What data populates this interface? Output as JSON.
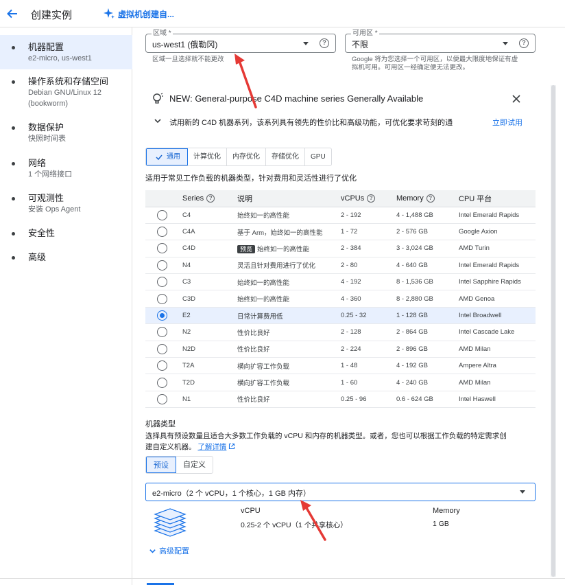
{
  "header": {
    "title": "创建实例",
    "vm_link": "虚拟机创建自..."
  },
  "sidebar": {
    "items": [
      {
        "title": "机器配置",
        "sub": "e2-micro, us-west1"
      },
      {
        "title": "操作系统和存储空间",
        "sub": "Debian GNU/Linux 12",
        "sub2": "(bookworm)"
      },
      {
        "title": "数据保护",
        "sub": "快照时间表"
      },
      {
        "title": "网络",
        "sub": "1 个网络接口"
      },
      {
        "title": "可观测性",
        "sub": "安装 Ops Agent"
      },
      {
        "title": "安全性",
        "sub": ""
      },
      {
        "title": "高级",
        "sub": ""
      }
    ]
  },
  "region": {
    "label": "区域 *",
    "value": "us-west1 (俄勒冈)",
    "helper": "区域一旦选择就不能更改"
  },
  "zone": {
    "label": "可用区 *",
    "value": "不限",
    "helper_line1": "Google 将为您选择一个可用区，以便最大限度地保证有虚",
    "helper_line2": "拟机可用。可用区一经确定便无法更改。"
  },
  "banner": {
    "title": "NEW: General-purpose C4D machine series Generally Available",
    "subtitle": "试用新的 C4D 机器系列，该系列具有领先的性价比和高级功能，可优化要求苛刻的通",
    "action": "立即试用"
  },
  "families": {
    "tabs": [
      "通用",
      "计算优化",
      "内存优化",
      "存储优化",
      "GPU"
    ],
    "selected": 0,
    "description": "适用于常见工作负载的机器类型，针对费用和灵活性进行了优化"
  },
  "series_table": {
    "headers": {
      "series": "Series",
      "desc": "说明",
      "vcpus": "vCPUs",
      "memory": "Memory",
      "platform": "CPU 平台"
    },
    "rows": [
      {
        "series": "C4",
        "desc": "始终如一的高性能",
        "vcpus": "2 - 192",
        "memory": "4 - 1,488 GB",
        "platform": "Intel Emerald Rapids"
      },
      {
        "series": "C4A",
        "desc": "基于 Arm，始终如一的高性能",
        "vcpus": "1 - 72",
        "memory": "2 - 576 GB",
        "platform": "Google Axion"
      },
      {
        "series": "C4D",
        "badge": "预览",
        "desc": "始终如一的高性能",
        "vcpus": "2 - 384",
        "memory": "3 - 3,024 GB",
        "platform": "AMD Turin"
      },
      {
        "series": "N4",
        "desc": "灵活且针对费用进行了优化",
        "vcpus": "2 - 80",
        "memory": "4 - 640 GB",
        "platform": "Intel Emerald Rapids"
      },
      {
        "series": "C3",
        "desc": "始终如一的高性能",
        "vcpus": "4 - 192",
        "memory": "8 - 1,536 GB",
        "platform": "Intel Sapphire Rapids"
      },
      {
        "series": "C3D",
        "desc": "始终如一的高性能",
        "vcpus": "4 - 360",
        "memory": "8 - 2,880 GB",
        "platform": "AMD Genoa"
      },
      {
        "series": "E2",
        "desc": "日常计算费用低",
        "vcpus": "0.25 - 32",
        "memory": "1 - 128 GB",
        "platform": "Intel Broadwell"
      },
      {
        "series": "N2",
        "desc": "性价比良好",
        "vcpus": "2 - 128",
        "memory": "2 - 864 GB",
        "platform": "Intel Cascade Lake"
      },
      {
        "series": "N2D",
        "desc": "性价比良好",
        "vcpus": "2 - 224",
        "memory": "2 - 896 GB",
        "platform": "AMD Milan"
      },
      {
        "series": "T2A",
        "desc": "横向扩容工作负载",
        "vcpus": "1 - 48",
        "memory": "4 - 192 GB",
        "platform": "Ampere Altra"
      },
      {
        "series": "T2D",
        "desc": "横向扩容工作负载",
        "vcpus": "1 - 60",
        "memory": "4 - 240 GB",
        "platform": "AMD Milan"
      },
      {
        "series": "N1",
        "desc": "性价比良好",
        "vcpus": "0.25 - 96",
        "memory": "0.6 - 624 GB",
        "platform": "Intel Haswell"
      }
    ],
    "selected_index": 6
  },
  "machine_type": {
    "title": "机器类型",
    "desc_line1": "选择具有预设数量且适合大多数工作负载的 vCPU 和内存的机器类型。或者，您也可以根据工作负载的特定需求创",
    "desc_line2": "建自定义机器。",
    "learn_more": "了解详情",
    "tabs": [
      "预设",
      "自定义"
    ],
    "selected_tab": 0,
    "value": "e2-micro（2 个 vCPU，1 个核心，1 GB 内存）",
    "vcpu_label": "vCPU",
    "vcpu_value": "0.25-2 个 vCPU（1 个共享核心）",
    "memory_label": "Memory",
    "memory_value": "1 GB",
    "advanced": "高级配置"
  },
  "colors": {
    "accent": "#1a73e8",
    "arrow": "#e53935"
  }
}
